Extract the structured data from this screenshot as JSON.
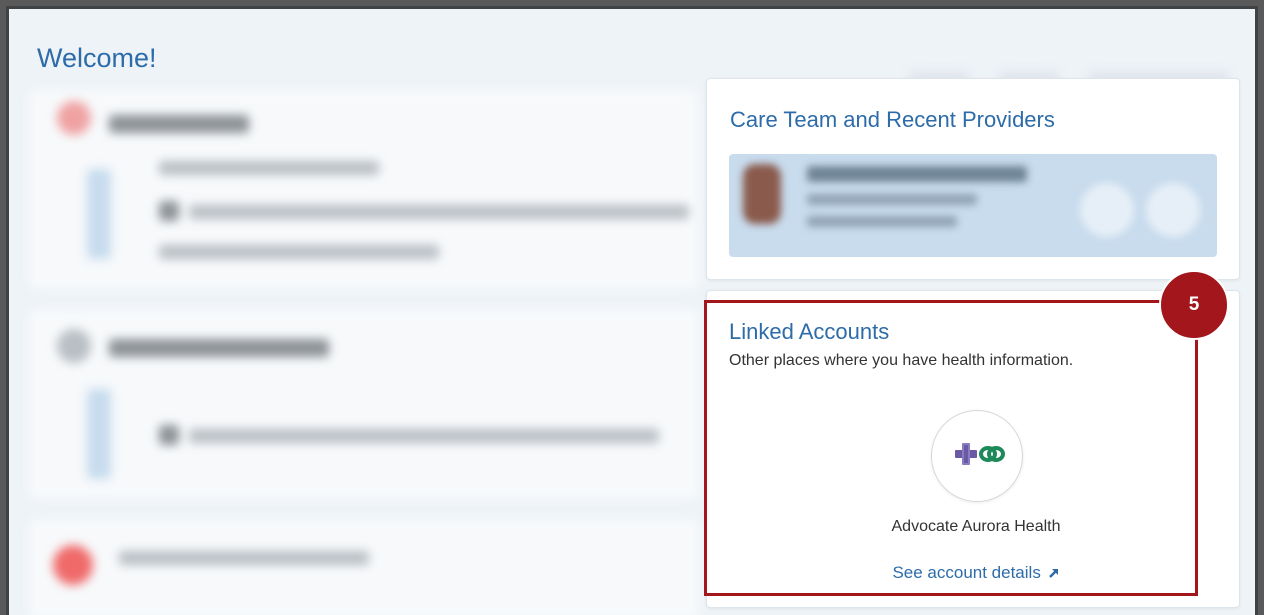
{
  "page": {
    "welcome": "Welcome!"
  },
  "care_team": {
    "title": "Care Team and Recent Providers"
  },
  "linked_accounts": {
    "title": "Linked Accounts",
    "subtitle": "Other places where you have health information.",
    "organization": "Advocate Aurora Health",
    "details_link": "See account details",
    "link_icon": "external-link-icon"
  },
  "annotation": {
    "step_number": "5",
    "color": "#a3161b"
  },
  "colors": {
    "accent_blue": "#2d6ca8",
    "logo_purple": "#6a5aa6",
    "logo_green": "#1e8a5a"
  }
}
